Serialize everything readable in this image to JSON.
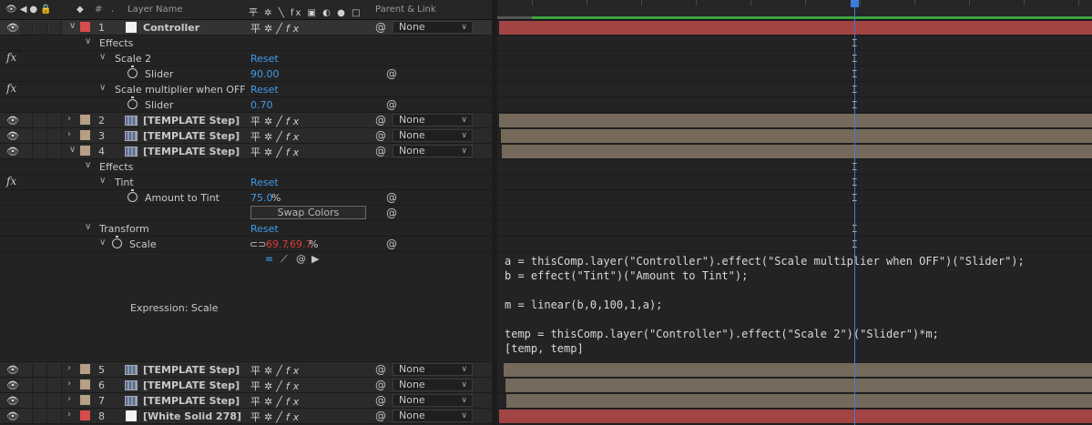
{
  "header": {
    "layer_name_col": "Layer Name",
    "parent_col": "Parent & Link",
    "icons": [
      "eye-icon",
      "audio-icon",
      "solo-icon",
      "lock-icon",
      "label-icon",
      "hash-icon"
    ],
    "switch_icons": "平 ✲ ╲ fx ▣ ◐ ● □"
  },
  "layers": [
    {
      "num": "1",
      "name": "Controller",
      "color": "#d84c4c",
      "parent": "None",
      "type": "null"
    },
    {
      "num": "2",
      "name": "[TEMPLATE Step]",
      "color": "#b59f85",
      "parent": "None",
      "type": "comp"
    },
    {
      "num": "3",
      "name": "[TEMPLATE Step]",
      "color": "#b59f85",
      "parent": "None",
      "type": "comp"
    },
    {
      "num": "4",
      "name": "[TEMPLATE Step]",
      "color": "#b59f85",
      "parent": "None",
      "type": "comp"
    },
    {
      "num": "5",
      "name": "[TEMPLATE Step]",
      "color": "#b59f85",
      "parent": "None",
      "type": "comp"
    },
    {
      "num": "6",
      "name": "[TEMPLATE Step]",
      "color": "#b59f85",
      "parent": "None",
      "type": "comp"
    },
    {
      "num": "7",
      "name": "[TEMPLATE Step]",
      "color": "#b59f85",
      "parent": "None",
      "type": "comp"
    },
    {
      "num": "8",
      "name": "[White Solid 278]",
      "color": "#d84c4c",
      "parent": "None",
      "type": "solid"
    }
  ],
  "props": {
    "effects": "Effects",
    "scale2": "Scale 2",
    "reset": "Reset",
    "slider": "Slider",
    "slider1_val": "90.00",
    "scale_mult": "Scale multiplier when OFF",
    "slider2_val": "0.70",
    "tint": "Tint",
    "amount_to_tint": "Amount to Tint",
    "amount_val": "75.0",
    "percent": "%",
    "swap_colors": "Swap Colors",
    "transform": "Transform",
    "scale": "Scale",
    "scale_x": "69.7",
    "scale_sep": ",",
    "scale_y": "69.7",
    "expression_label": "Expression: Scale",
    "fx": "fx"
  },
  "expression": {
    "lines": [
      "a = thisComp.layer(\"Controller\").effect(\"Scale multiplier when OFF\")(\"Slider\");",
      "b = effect(\"Tint\")(\"Amount to Tint\");",
      "",
      "m = linear(b,0,100,1,a);",
      "",
      "temp = thisComp.layer(\"Controller\").effect(\"Scale 2\")(\"Slider\")*m;",
      "[temp, temp]"
    ]
  },
  "colors": {
    "accent": "#3f9bea",
    "playhead": "#3d7cd8",
    "red_bar": "#a24444",
    "tan_bar": "#74695a",
    "work_area": "#3fa33f"
  }
}
